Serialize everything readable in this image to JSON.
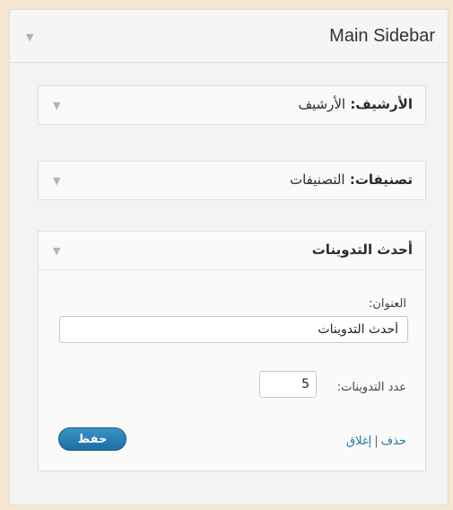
{
  "sidebar": {
    "title": "Main Sidebar",
    "toggle_glyph": "▼"
  },
  "widgets": {
    "archives": {
      "title": "الأرشيف:",
      "subtitle": "الأرشيف"
    },
    "categories": {
      "title": "تصنيفات:",
      "subtitle": "التصنيفات"
    },
    "recent_posts": {
      "title": "أحدث التدوينات",
      "title_label": "العنوان:",
      "title_value": "أحدث التدوينات",
      "count_label": "عدد التدوينات:",
      "count_value": "5",
      "delete_label": "حذف",
      "separator": "|",
      "close_label": "إغلاق",
      "save_label": "حفظ"
    }
  },
  "colors": {
    "background": "#f4e6cf",
    "panel": "#f3f3f3",
    "link": "#21759b",
    "save_button": "#2a80b4"
  }
}
